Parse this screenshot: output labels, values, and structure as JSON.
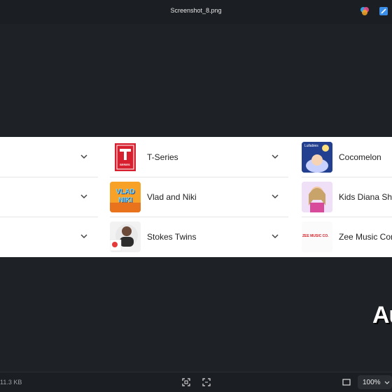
{
  "window": {
    "title": "Screenshot_8.png"
  },
  "content": {
    "columns": [
      {
        "rows": [
          {
            "name": ""
          },
          {
            "name": ""
          },
          {
            "name": ""
          }
        ]
      },
      {
        "rows": [
          {
            "name": "T-Series",
            "thumb_icon": "t-series-logo"
          },
          {
            "name": "Vlad and Niki",
            "thumb_icon": "vlad-niki-logo"
          },
          {
            "name": "Stokes Twins",
            "thumb_icon": "stokes-twins-avatar"
          }
        ]
      },
      {
        "rows": [
          {
            "name": "Cocomelon",
            "thumb_icon": "cocomelon-logo"
          },
          {
            "name": "Kids Diana Sho",
            "thumb_icon": "kids-diana-show-avatar"
          },
          {
            "name": "Zee Music Com",
            "thumb_icon": "zee-music-logo"
          }
        ]
      }
    ],
    "thumb_texts": {
      "tseries": "SERIES",
      "vlad": "VLAD NIKI",
      "cocomelon_top": "Lullabies",
      "zee": "ZEE MUSIC CO."
    },
    "partial_overlay_text": "Au"
  },
  "statusbar": {
    "file_size": "11.3 KB",
    "zoom": "100%"
  },
  "colors": {
    "background": "#1b1e22",
    "panel": "#ffffff",
    "tseries_red": "#d6202f",
    "vlad_orange": "#f39a1e",
    "zee_red": "#d62028"
  }
}
